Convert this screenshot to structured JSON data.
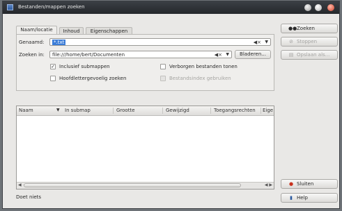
{
  "window": {
    "title": "Bestanden/mappen zoeken"
  },
  "tabs": [
    {
      "label": "Naam/locatie",
      "active": true
    },
    {
      "label": "Inhoud",
      "active": false
    },
    {
      "label": "Eigenschappen",
      "active": false
    }
  ],
  "form": {
    "name_label": "Genaamd:",
    "name_value": "*.txt",
    "lookin_label": "Zoeken in:",
    "lookin_value": "file:///home/bert/Documenten",
    "browse_label": "Bladeren...",
    "clear_icon": "clear-text-icon",
    "dropdown_icon": "chevron-down-icon"
  },
  "checkboxes": [
    {
      "label": "Inclusief submappen",
      "checked": true,
      "enabled": true
    },
    {
      "label": "Verborgen bestanden tonen",
      "checked": false,
      "enabled": true
    },
    {
      "label": "Hoofdlettergevoelig zoeken",
      "checked": false,
      "enabled": true
    },
    {
      "label": "Bestandsindex gebruiken",
      "checked": false,
      "enabled": false
    }
  ],
  "actions": {
    "find": {
      "label": "Zoeken",
      "icon": "binoculars-icon",
      "enabled": true
    },
    "stop": {
      "label": "Stoppen",
      "icon": "stop-icon",
      "enabled": false
    },
    "save": {
      "label": "Opslaan als...",
      "icon": "save-icon",
      "enabled": false
    },
    "close": {
      "label": "Sluiten",
      "icon": "close-icon",
      "enabled": true
    },
    "help": {
      "label": "Help",
      "icon": "help-icon",
      "enabled": true
    }
  },
  "results": {
    "columns": [
      "Naam",
      "In submap",
      "Grootte",
      "Gewijzigd",
      "Toegangsrechten",
      "Eige"
    ],
    "rows": []
  },
  "status": {
    "text": "Doet niets"
  },
  "colors": {
    "selection": "#3b7dd8",
    "window_bg": "#e9e8e6",
    "titlebar": "#2b2e33"
  }
}
